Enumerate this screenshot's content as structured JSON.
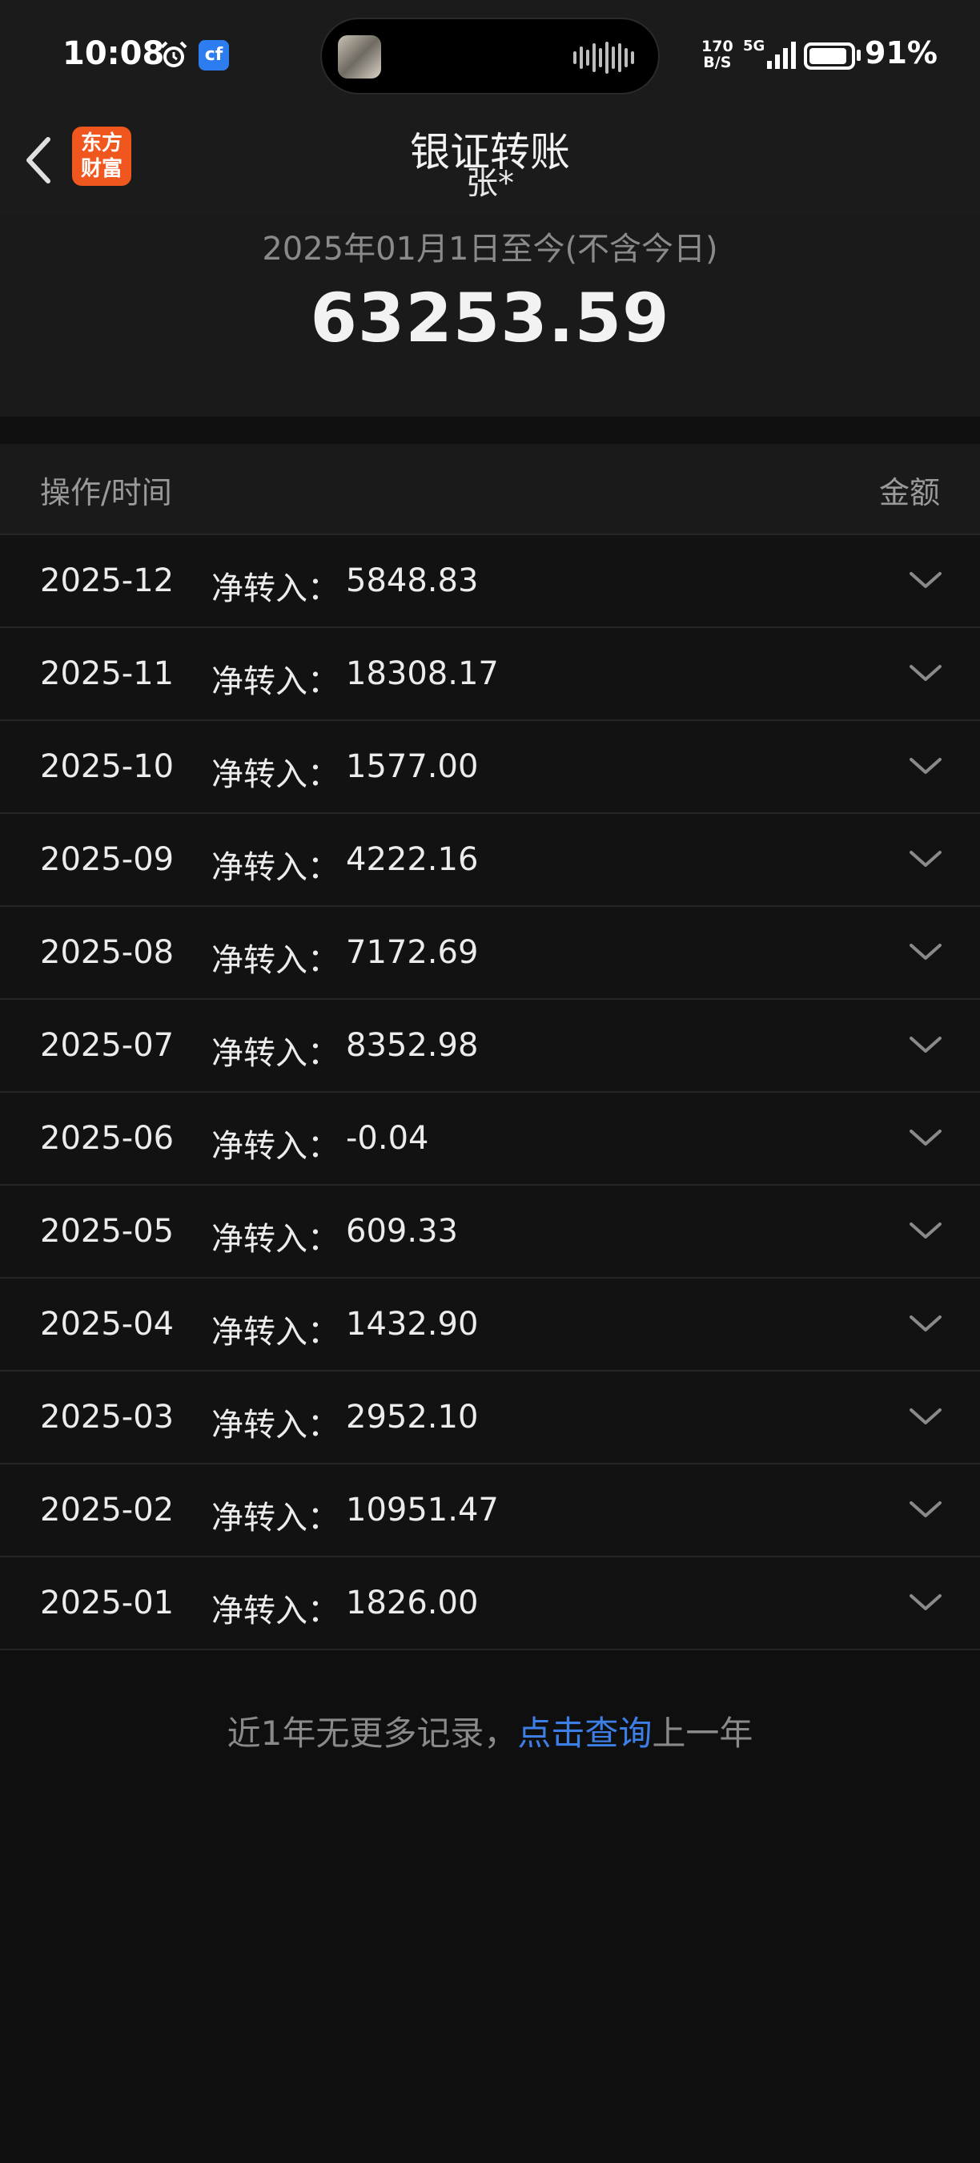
{
  "status_bar": {
    "time": "10:08",
    "speed_line1": "170",
    "speed_line2": "B/S",
    "network": "5G",
    "battery_percent": "91%",
    "battery_level": 0.91,
    "app_icon_text": "cf"
  },
  "header": {
    "back_icon": "chevron-left-icon",
    "logo_line1": "东方",
    "logo_line2": "财富",
    "title": "银证转账",
    "subtitle": "张*"
  },
  "summary": {
    "period": "2025年01月1日至今(不含今日)",
    "total": "63253.59"
  },
  "table": {
    "header_left": "操作/时间",
    "header_right": "金额",
    "rows": [
      {
        "date": "2025-12",
        "label": "净转入：",
        "amount": "5848.83"
      },
      {
        "date": "2025-11",
        "label": "净转入：",
        "amount": "18308.17"
      },
      {
        "date": "2025-10",
        "label": "净转入：",
        "amount": "1577.00"
      },
      {
        "date": "2025-09",
        "label": "净转入：",
        "amount": "4222.16"
      },
      {
        "date": "2025-08",
        "label": "净转入：",
        "amount": "7172.69"
      },
      {
        "date": "2025-07",
        "label": "净转入：",
        "amount": "8352.98"
      },
      {
        "date": "2025-06",
        "label": "净转入：",
        "amount": "-0.04"
      },
      {
        "date": "2025-05",
        "label": "净转入：",
        "amount": "609.33"
      },
      {
        "date": "2025-04",
        "label": "净转入：",
        "amount": "1432.90"
      },
      {
        "date": "2025-03",
        "label": "净转入：",
        "amount": "2952.10"
      },
      {
        "date": "2025-02",
        "label": "净转入：",
        "amount": "10951.47"
      },
      {
        "date": "2025-01",
        "label": "净转入：",
        "amount": "1826.00"
      }
    ]
  },
  "footer": {
    "prefix": "近1年无更多记录，",
    "link": "点击查询",
    "suffix": "上一年"
  },
  "colors": {
    "background": "#0f0f0f",
    "link": "#3d7fe6",
    "brand": "#f0571e"
  }
}
